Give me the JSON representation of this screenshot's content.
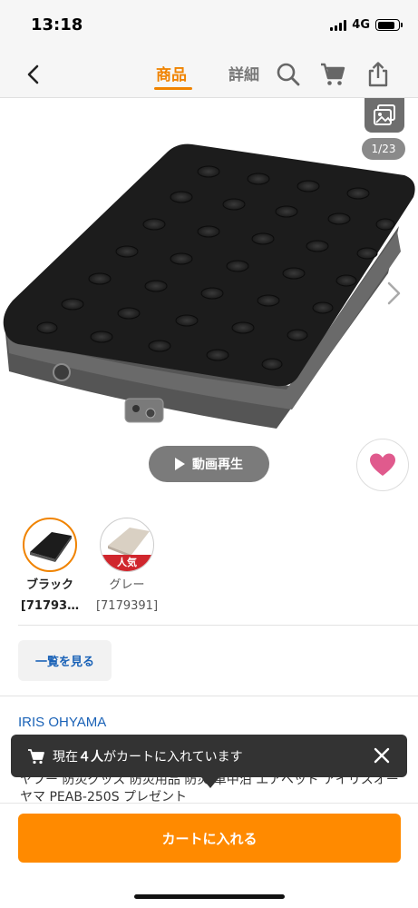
{
  "status_bar": {
    "time": "13:18",
    "network": "4G"
  },
  "nav": {
    "tab_product": "商品",
    "tab_detail": "詳細"
  },
  "gallery": {
    "counter": "1/23"
  },
  "video_button": {
    "label": "動画再生"
  },
  "variants": [
    {
      "name": "ブラック",
      "code": "[71793…",
      "selected": true
    },
    {
      "name": "グレー",
      "code": "[7179391]",
      "badge": "人気",
      "selected": false
    }
  ],
  "view_all_label": "一覧を見る",
  "brand": "IRIS OHYAMA",
  "toast": {
    "prefix": "現在",
    "count": "４人",
    "suffix": "がカートに入れています"
  },
  "product_title": "ヤフー 防災グッズ 防災用品 防災 車中泊 エアベッド アイリスオーヤマ PEAB-250S プレゼント",
  "cart_button": "カートに入れる",
  "colors": {
    "accent": "#f08300",
    "cart": "#ff8a00",
    "link": "#1a62b7",
    "favorite": "#e05a8d",
    "badge": "#d0262d"
  }
}
